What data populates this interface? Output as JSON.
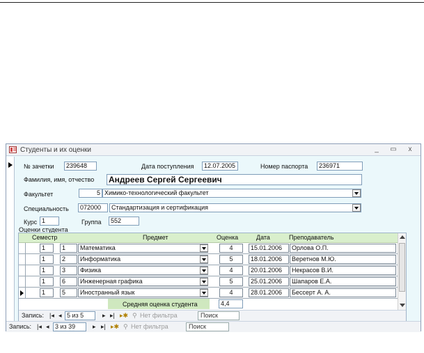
{
  "window": {
    "title": "Студенты и их оценки",
    "buttons": {
      "minimize": "_",
      "maximize": "▭",
      "close": "x"
    }
  },
  "form": {
    "record_book_label": "№ зачетки",
    "record_book": "239648",
    "admission_date_label": "Дата поступления",
    "admission_date": "12.07.2005",
    "passport_label": "Номер паспорта",
    "passport": "236971",
    "name_label": "Фамилия, имя, отчество",
    "name": "Андреев Сергей Сергеевич",
    "faculty_label": "Факультет",
    "faculty_code": "5",
    "faculty_name": "Химико-технологический факультет",
    "specialty_label": "Специальность",
    "specialty_code": "072000",
    "specialty_name": "Стандартизация и сертификация",
    "course_label": "Курс",
    "course": "1",
    "group_label": "Группа",
    "group": "552",
    "grades_label": "Оценки студента"
  },
  "grades": {
    "columns": {
      "semester": "Семестр",
      "subject": "Предмет",
      "grade": "Оценка",
      "date": "Дата",
      "teacher": "Преподаватель"
    },
    "rows": [
      {
        "semester": "1",
        "code": "1",
        "subject": "Математика",
        "grade": "4",
        "date": "15.01.2006",
        "teacher": "Орлова О.П."
      },
      {
        "semester": "1",
        "code": "2",
        "subject": "Информатика",
        "grade": "5",
        "date": "18.01.2006",
        "teacher": "Веретнов М.Ю."
      },
      {
        "semester": "1",
        "code": "3",
        "subject": "Физика",
        "grade": "4",
        "date": "20.01.2006",
        "teacher": "Некрасов В.И."
      },
      {
        "semester": "1",
        "code": "6",
        "subject": "Инженерная графика",
        "grade": "5",
        "date": "25.01.2006",
        "teacher": "Шапаров Е.А."
      },
      {
        "semester": "1",
        "code": "5",
        "subject": "Иностранный язык",
        "grade": "4",
        "date": "28.01.2006",
        "teacher": "Бессерт А. А."
      }
    ],
    "average_label": "Средняя оценка студента",
    "average": "4,4"
  },
  "subform_nav": {
    "label": "Запись:",
    "first": "|◂",
    "prev": "◂",
    "position": "5 из 5",
    "next": "▸",
    "last": "▸|",
    "new": "▸✱",
    "filter": "Нет фильтра",
    "search": "Поиск"
  },
  "main_nav": {
    "label": "Запись:",
    "first": "|◂",
    "prev": "◂",
    "position": "3 из 39",
    "next": "▸",
    "last": "▸|",
    "new": "▸✱",
    "filter": "Нет фильтра",
    "search": "Поиск"
  },
  "colors": {
    "form_bg": "#ebf8fb",
    "header_bg": "#d9efcc",
    "average_bg": "#cfe8bf"
  }
}
